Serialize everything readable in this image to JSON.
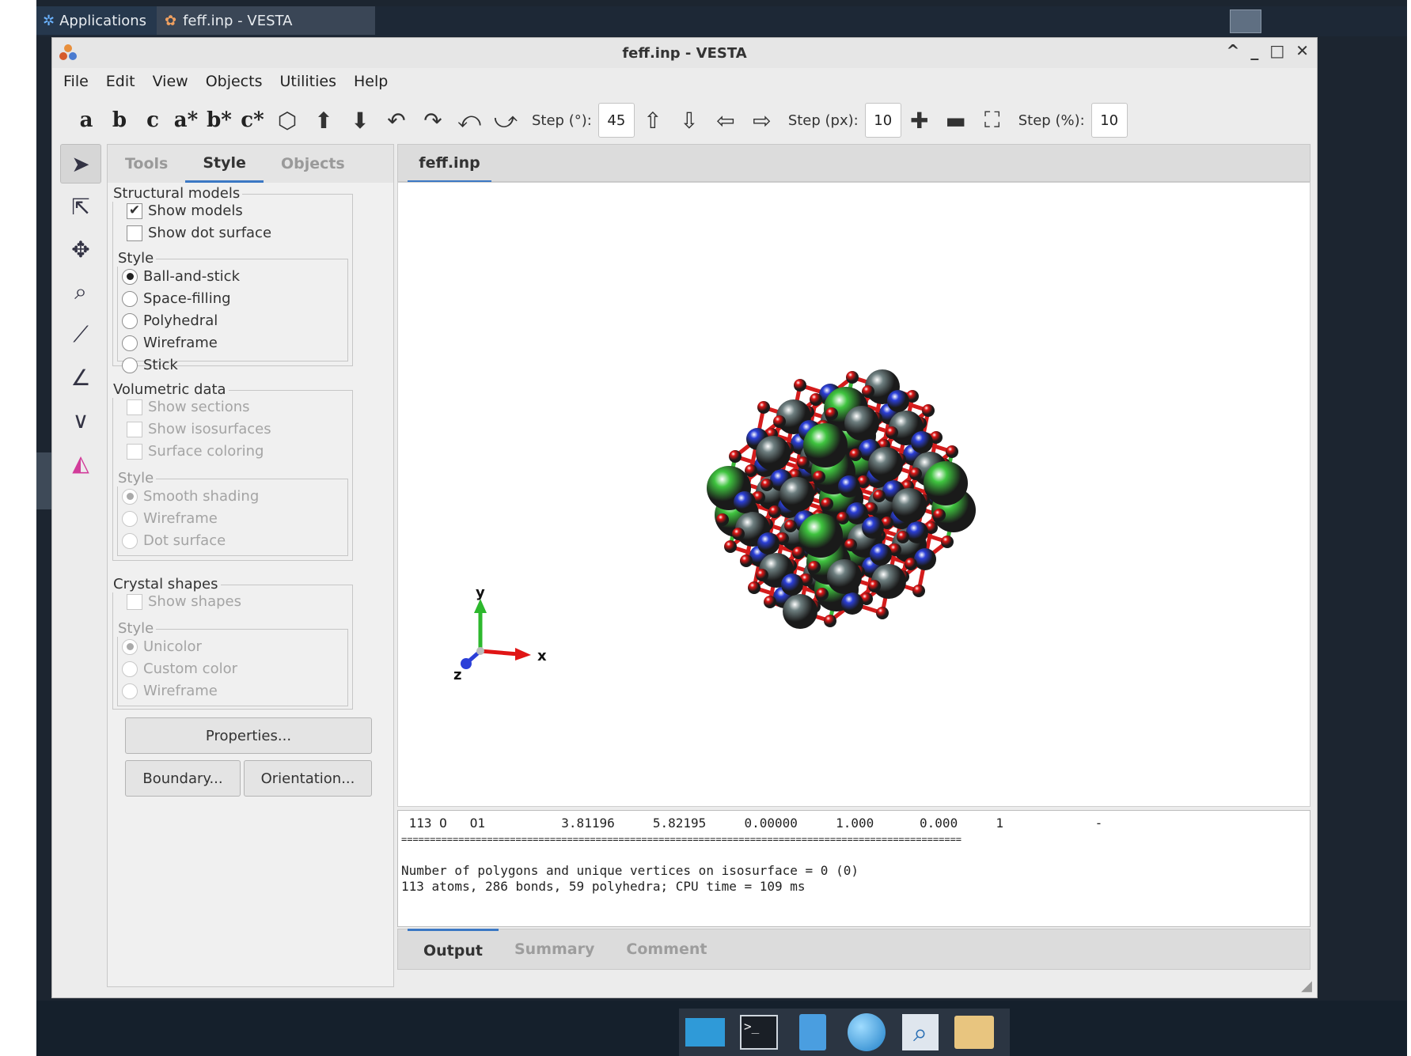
{
  "panel": {
    "apps_label": "Applications",
    "task_label": "feff.inp - VESTA"
  },
  "window": {
    "title": "feff.inp - VESTA",
    "controls": [
      "^",
      "_",
      "□",
      "✕"
    ]
  },
  "menu": [
    "File",
    "Edit",
    "View",
    "Objects",
    "Utilities",
    "Help"
  ],
  "toolbar": {
    "axis_buttons": [
      "a",
      "b",
      "c",
      "a*",
      "b*",
      "c*"
    ],
    "step_deg_label": "Step (°):",
    "step_deg_value": "45",
    "step_px_label": "Step (px):",
    "step_px_value": "10",
    "step_pct_label": "Step (%):",
    "step_pct_value": "10"
  },
  "side_tabs": [
    "Tools",
    "Style",
    "Objects"
  ],
  "structural": {
    "title": "Structural models",
    "show_models": "Show models",
    "show_dot_surface": "Show dot surface",
    "style_title": "Style",
    "styles": [
      "Ball-and-stick",
      "Space-filling",
      "Polyhedral",
      "Wireframe",
      "Stick"
    ]
  },
  "volumetric": {
    "title": "Volumetric data",
    "show_sections": "Show sections",
    "show_isosurfaces": "Show isosurfaces",
    "surface_coloring": "Surface coloring",
    "style_title": "Style",
    "styles": [
      "Smooth shading",
      "Wireframe",
      "Dot surface"
    ]
  },
  "crystal": {
    "title": "Crystal shapes",
    "show_shapes": "Show shapes",
    "style_title": "Style",
    "styles": [
      "Unicolor",
      "Custom color",
      "Wireframe"
    ]
  },
  "buttons": {
    "properties": "Properties...",
    "boundary": "Boundary...",
    "orientation": "Orientation..."
  },
  "viewer": {
    "tab": "feff.inp",
    "axes": {
      "x": "x",
      "y": "y",
      "z": "z"
    }
  },
  "output": {
    "lines": [
      " 113 O   O1          3.81196     5.82195     0.00000     1.000      0.000     1            -",
      "==================================================================================================",
      "",
      "Number of polygons and unique vertices on isosurface = 0 (0)",
      "113 atoms, 286 bonds, 59 polyhedra; CPU time = 109 ms"
    ]
  },
  "output_tabs": [
    "Output",
    "Summary",
    "Comment"
  ],
  "colors": {
    "chlorine": "#3fc43f",
    "oxygen": "#e01515",
    "nitrogen": "#2b3fd8",
    "grey_atom": "#6e7f80",
    "accent": "#3b78c4"
  }
}
